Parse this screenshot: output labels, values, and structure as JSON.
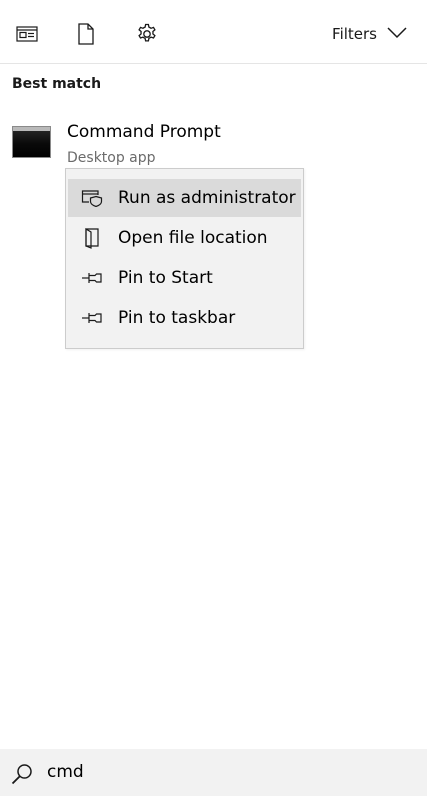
{
  "toolbar": {
    "icons": [
      "news-feed-icon",
      "document-icon",
      "gear-icon"
    ],
    "filters_label": "Filters"
  },
  "results": {
    "section_title": "Best match",
    "best_match": {
      "name": "Command Prompt",
      "type": "Desktop app",
      "icon": "command-prompt-icon"
    }
  },
  "context_menu": {
    "items": [
      {
        "label": "Run as administrator",
        "icon": "shield-window-icon",
        "highlighted": true
      },
      {
        "label": "Open file location",
        "icon": "file-location-icon",
        "highlighted": false
      },
      {
        "label": "Pin to Start",
        "icon": "pin-icon",
        "highlighted": false
      },
      {
        "label": "Pin to taskbar",
        "icon": "pin-icon",
        "highlighted": false
      }
    ]
  },
  "search": {
    "value": "cmd",
    "icon": "search-icon"
  },
  "colors": {
    "menu_background": "#f2f2f2",
    "menu_highlight": "#dadada",
    "search_background": "#f2f2f2",
    "secondary_text": "#6b6b6b"
  }
}
